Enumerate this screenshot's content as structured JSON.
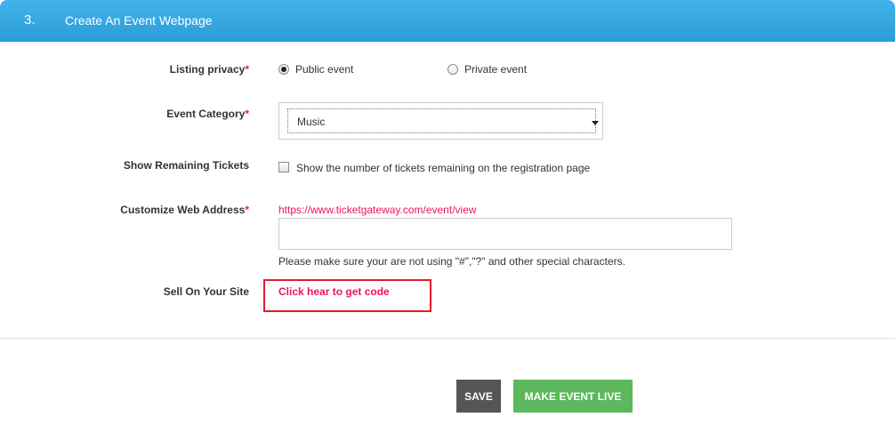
{
  "header": {
    "number": "3.",
    "title": "Create An Event Webpage",
    "color": "#2c9cd8"
  },
  "form": {
    "required_mark": "*",
    "listing_privacy": {
      "label": "Listing privacy",
      "options": [
        {
          "label": "Public event",
          "checked": true
        },
        {
          "label": "Private event",
          "checked": false
        }
      ]
    },
    "event_category": {
      "label": "Event Category",
      "selected": "Music"
    },
    "remaining_tickets": {
      "label": "Show Remaining Tickets",
      "checkbox_label": "Show the number of tickets remaining on the registration page",
      "checked": false
    },
    "web_address": {
      "label": "Customize Web Address",
      "base_url": "https://www.ticketgateway.com/event/view",
      "value": "",
      "help": "Please make sure your are not using \"#\",\"?\" and other special characters."
    },
    "sell_on_site": {
      "label": "Sell On Your Site",
      "link": "Click hear to get code",
      "highlight_color": "#e21a2c"
    }
  },
  "actions": {
    "save": "SAVE",
    "make_live": "MAKE EVENT LIVE"
  },
  "colors": {
    "accent_pink": "#e8175d",
    "save_bg": "#555555",
    "live_bg": "#5cb85c"
  }
}
